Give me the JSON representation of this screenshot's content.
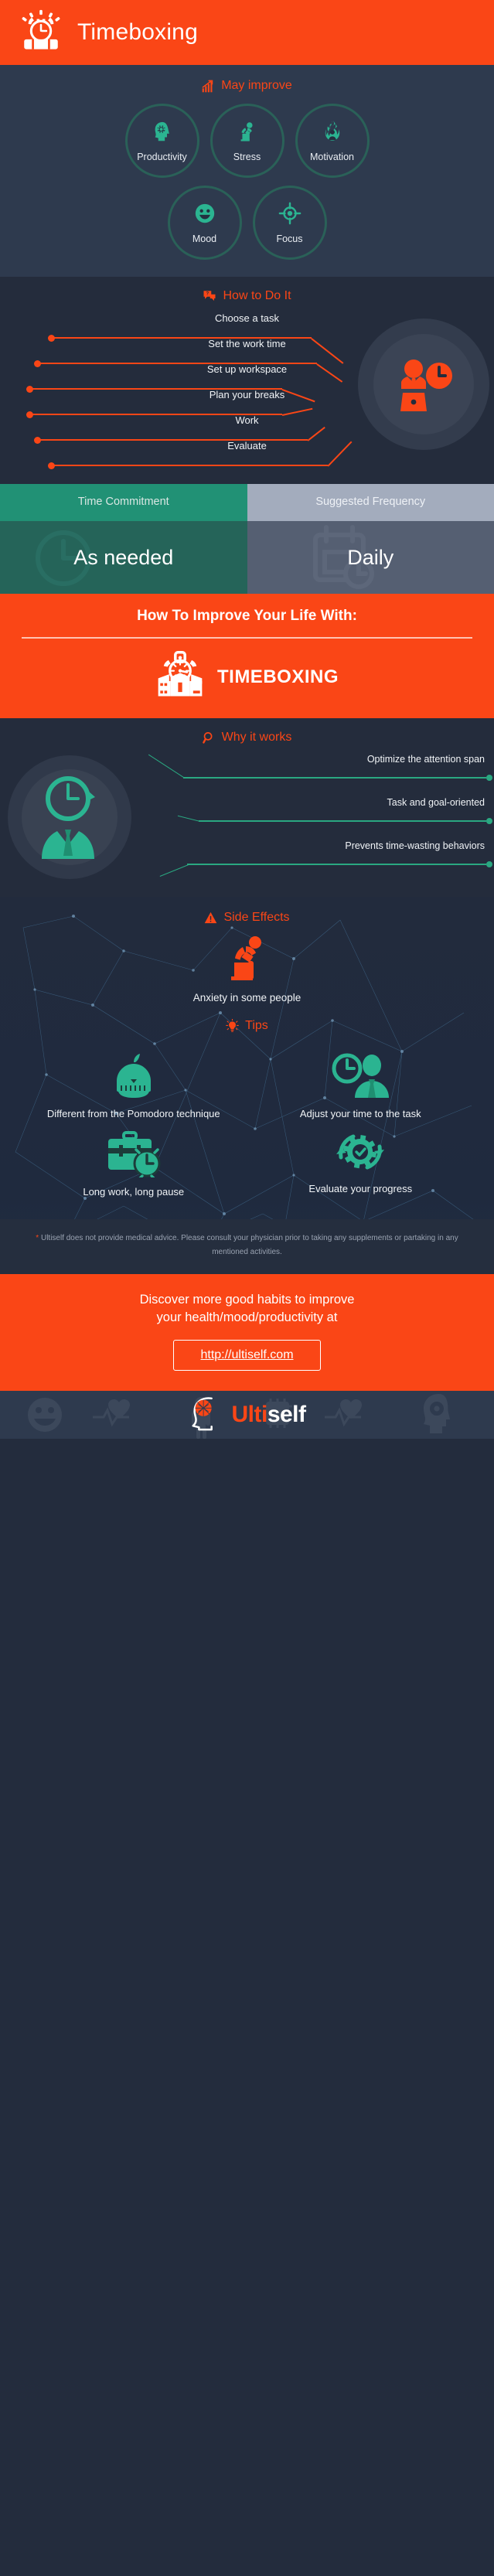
{
  "header": {
    "title": "Timeboxing",
    "icon": "alarm-clock-box-icon",
    "bg": "#fa4616"
  },
  "may_improve": {
    "title": "May improve",
    "icon": "growth-chart-icon",
    "items": [
      {
        "label": "Productivity",
        "icon": "head-gear-icon"
      },
      {
        "label": "Stress",
        "icon": "stressed-person-icon"
      },
      {
        "label": "Motivation",
        "icon": "fire-person-icon"
      },
      {
        "label": "Mood",
        "icon": "smiley-face-icon"
      },
      {
        "label": "Focus",
        "icon": "target-icon"
      }
    ]
  },
  "how_to": {
    "title": "How to Do It",
    "icon": "question-bubble-icon",
    "illustration": "businessman-clock-icon",
    "steps": [
      "Choose a task",
      "Set the work time",
      "Set up workspace",
      "Plan your breaks",
      "Work",
      "Evaluate"
    ]
  },
  "panels": [
    {
      "heading": "Time Commitment",
      "value": "As needed",
      "watermark": "clock-icon",
      "head_bg": "#219175",
      "body_bg": "#256459"
    },
    {
      "heading": "Suggested Frequency",
      "value": "Daily",
      "watermark": "calendar-clock-icon",
      "head_bg": "#a3acbd",
      "body_bg": "#555f72"
    }
  ],
  "band": {
    "heading": "How To Improve Your Life With:",
    "logo_word": "TIMEBOXING",
    "logo_icon": "alarm-clock-open-box-icon"
  },
  "why_it_works": {
    "title": "Why it works",
    "icon": "magnifier-icon",
    "illustration": "person-clock-arrow-icon",
    "items": [
      "Optimize the attention span",
      "Task and goal-oriented",
      "Prevents time-wasting behaviors"
    ]
  },
  "side_effects": {
    "title": "Side Effects",
    "icon": "warning-triangle-icon",
    "items": [
      {
        "label": "Anxiety in some people",
        "icon": "anxious-person-icon"
      }
    ]
  },
  "tips": {
    "title": "Tips",
    "icon": "lightbulb-icon",
    "items": [
      {
        "label": "Different from the Pomodoro technique",
        "icon": "tomato-timer-icon"
      },
      {
        "label": "Adjust your time to the task",
        "icon": "person-clock-icon"
      },
      {
        "label": "Long work, long pause",
        "icon": "briefcase-alarm-icon"
      },
      {
        "label": "Evaluate your progress",
        "icon": "gear-refresh-check-icon"
      }
    ]
  },
  "disclaimer": {
    "star": "*",
    "text": " Ultiself does not provide medical advice. Please consult your physician prior to taking any supplements or partaking in any mentioned activities."
  },
  "footer_cta": {
    "line1": "Discover more good habits to improve",
    "line2": "your health/mood/productivity at",
    "url": "http://ultiself.com"
  },
  "brand": {
    "name_accent": "Ulti",
    "name_rest": "self",
    "icon": "brain-head-icon"
  },
  "colors": {
    "orange": "#fa4616",
    "green": "#2aa881",
    "teal_dark": "#2a6158",
    "bg_dark": "#242c3c",
    "bg_mid": "#2e3a4e",
    "text_light": "#f1f4f7"
  }
}
